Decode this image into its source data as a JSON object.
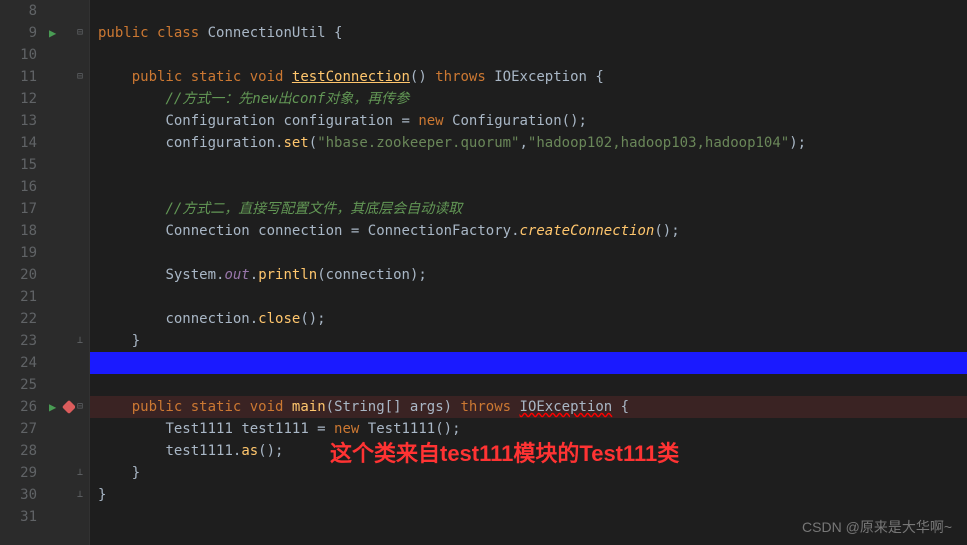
{
  "line_numbers": [
    "8",
    "9",
    "10",
    "11",
    "12",
    "13",
    "14",
    "15",
    "16",
    "17",
    "18",
    "19",
    "20",
    "21",
    "22",
    "23",
    "24",
    "25",
    "26",
    "27",
    "28",
    "29",
    "30",
    "31"
  ],
  "code": {
    "l9_kw1": "public",
    "l9_kw2": "class",
    "l9_cls": "ConnectionUtil",
    "l11_kw1": "public",
    "l11_kw2": "static",
    "l11_kw3": "void",
    "l11_method": "testConnection",
    "l11_kw4": "throws",
    "l11_ex": "IOException",
    "l12_comment": "//方式一：先new出conf对象，再传参",
    "l13_type": "Configuration",
    "l13_var": "configuration",
    "l13_kw": "new",
    "l13_ctor": "Configuration",
    "l14_var": "configuration",
    "l14_method": "set",
    "l14_str1": "\"hbase.zookeeper.quorum\"",
    "l14_str2": "\"hadoop102,hadoop103,hadoop104\"",
    "l17_comment": "//方式二，直接写配置文件，其底层会自动读取",
    "l18_type": "Connection",
    "l18_var": "connection",
    "l18_cls": "ConnectionFactory",
    "l18_method": "createConnection",
    "l20_cls": "System",
    "l20_field": "out",
    "l20_method": "println",
    "l20_arg": "connection",
    "l22_var": "connection",
    "l22_method": "close",
    "l26_kw1": "public",
    "l26_kw2": "static",
    "l26_kw3": "void",
    "l26_method": "main",
    "l26_param": "String[] args",
    "l26_kw4": "throws",
    "l26_ex": "IOException",
    "l27_type": "Test1111",
    "l27_var": "test1111",
    "l27_kw": "new",
    "l27_ctor": "Test1111",
    "l28_var": "test1111",
    "l28_method": "as"
  },
  "annotation": "这个类来自test111模块的Test111类",
  "watermark": "CSDN @原来是大华啊~"
}
